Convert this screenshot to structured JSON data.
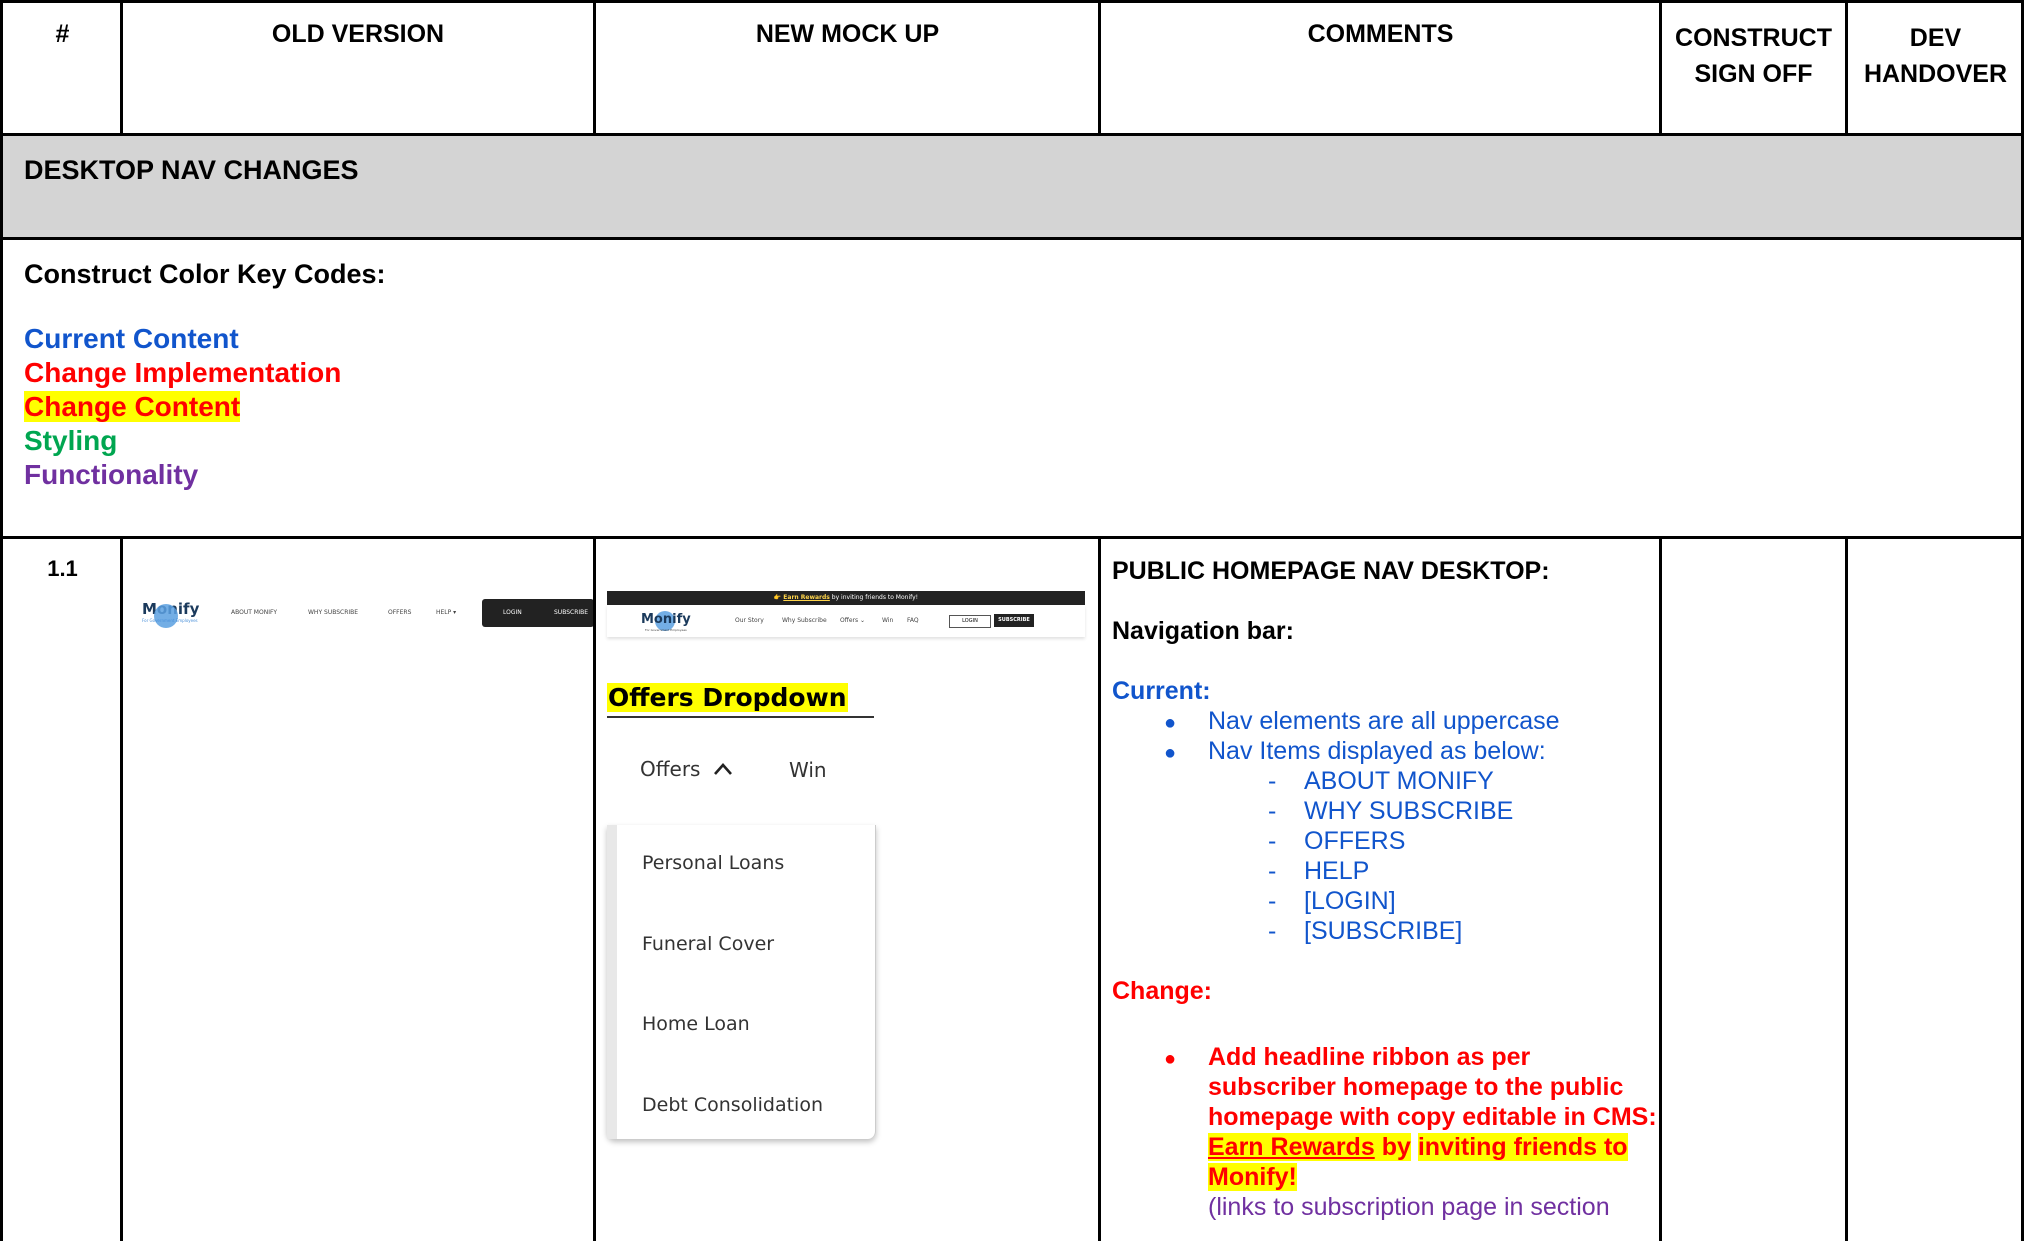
{
  "header": {
    "num": "#",
    "old_version": "OLD VERSION",
    "new_mock_up": "NEW MOCK UP",
    "comments": "COMMENTS",
    "construct_sign_off_1": "CONSTRUCT",
    "construct_sign_off_2": "SIGN OFF",
    "dev_handover_1": "DEV",
    "dev_handover_2": "HANDOVER"
  },
  "section": {
    "title": "DESKTOP NAV CHANGES"
  },
  "color_key": {
    "title": "Construct Color Key Codes:",
    "current_content": "Current Content",
    "change_implementation": "Change Implementation",
    "change_content": "Change Content",
    "styling": "Styling",
    "functionality": "Functionality",
    "colors": {
      "current": "#1155cc",
      "change": "#ff0000",
      "highlight": "#ffff00",
      "styling": "#00a650",
      "functionality": "#7030a0"
    }
  },
  "row": {
    "id": "1.1",
    "old_nav": {
      "logo": "Monify",
      "logo_sub": "For Government Employees",
      "items": [
        "ABOUT MONIFY",
        "WHY SUBSCRIBE",
        "OFFERS",
        "HELP ▾"
      ],
      "login": "LOGIN",
      "subscribe": "SUBSCRIBE"
    },
    "new_mock": {
      "ribbon_pre": "👉 ",
      "ribbon_link": "Earn Rewards",
      "ribbon_post": " by inviting friends to Monify!",
      "logo": "Monify",
      "logo_sub": "For Government Employees",
      "items": [
        "Our Story",
        "Why Subscribe",
        "Offers ⌄",
        "Win",
        "FAQ"
      ],
      "login": "LOGIN",
      "subscribe": "SUBSCRIBE",
      "dropdown_title": "Offers Dropdown",
      "dropdown_offers": "Offers",
      "dropdown_win": "Win",
      "dropdown_items": [
        "Personal Loans",
        "Funeral Cover",
        "Home Loan",
        "Debt Consolidation"
      ]
    },
    "comments": {
      "heading": "PUBLIC HOMEPAGE NAV DESKTOP:",
      "nav_bar": "Navigation bar:",
      "current_label": "Current:",
      "current_bullets": [
        "Nav elements are all uppercase",
        "Nav Items displayed as below:"
      ],
      "current_items": [
        "ABOUT MONIFY",
        "WHY SUBSCRIBE",
        "OFFERS",
        "HELP",
        "[LOGIN]",
        "[SUBSCRIBE]"
      ],
      "change_label": "Change:",
      "change_text": "Add headline ribbon as per subscriber homepage to the public homepage with copy editable in CMS:",
      "change_link": "Earn Rewards",
      "change_by": " by",
      "change_hl_tail": "inviting friends to Monify!",
      "change_func": "(links to subscription page in section"
    }
  }
}
